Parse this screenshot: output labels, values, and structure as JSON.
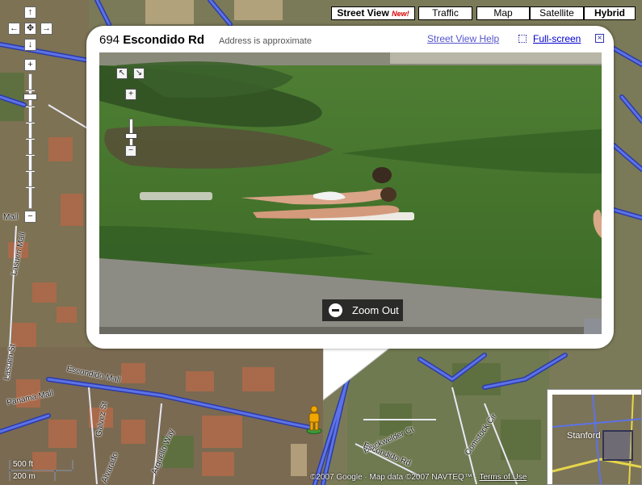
{
  "map": {
    "streets": [
      "Escondido Mall",
      "Panama Mall",
      "Lasuen Mall",
      "Lasuen St",
      "Galvez St",
      "Arguello Way",
      "Alvarado",
      "Blackwelder Ct",
      "Escondido Rd",
      "Comstock Cir",
      "Mall"
    ],
    "scale": {
      "feet": "500 ft",
      "meters": "200 m"
    },
    "copyright": {
      "text": "©2007 Google · Map data ©2007 NAVTEQ™ · ",
      "terms": "Terms of Use"
    },
    "overview_label": "Stanford"
  },
  "map_types": {
    "street_view": "Street View",
    "street_view_badge": "New!",
    "traffic": "Traffic",
    "map": "Map",
    "satellite": "Satellite",
    "hybrid": "Hybrid",
    "selected": "Hybrid"
  },
  "pan_controls": {
    "up": "↑",
    "left": "←",
    "center": "✥",
    "right": "→",
    "down": "↓",
    "zoom_in": "+",
    "zoom_out": "−"
  },
  "infowindow": {
    "address_number": "694",
    "address_road": "Escondido Rd",
    "approx_note": "Address is approximate",
    "help_link": "Street View Help",
    "fullscreen_link": "Full-screen",
    "close": "×"
  },
  "streetview": {
    "zoom_out_label": "Zoom Out",
    "zoom_in_symbol": "+",
    "zoom_out_symbol": "−",
    "pan_left": "↖",
    "pan_right": "↘"
  },
  "colors": {
    "road_blue": "#4a5fd0",
    "link_blue": "#0000cc",
    "badge_red": "#dd0000",
    "grass": "#4a7a30"
  }
}
